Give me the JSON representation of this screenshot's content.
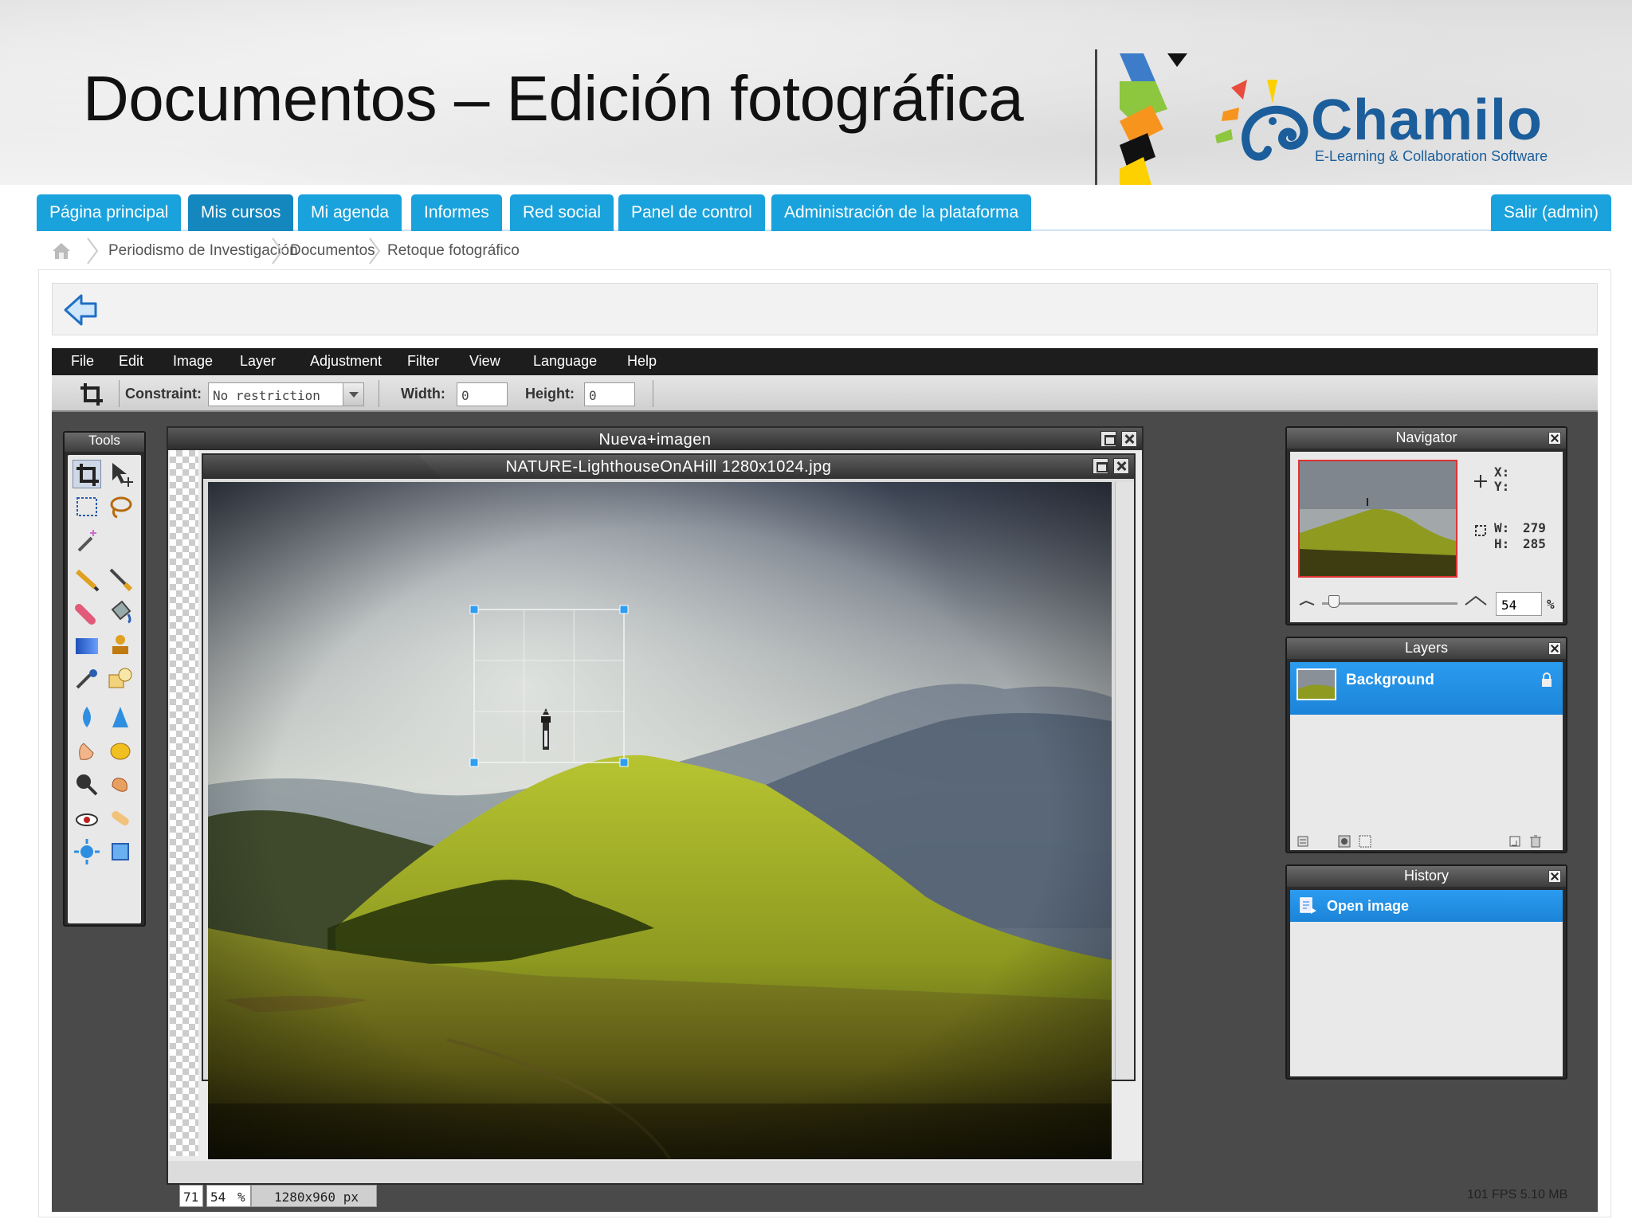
{
  "slide": {
    "title": "Documentos – Edición fotográfica",
    "logo_name": "Chamilo",
    "logo_tagline": "E-Learning & Collaboration Software"
  },
  "nav": {
    "tabs": [
      {
        "label": "Página principal",
        "active": false
      },
      {
        "label": "Mis cursos",
        "active": true
      },
      {
        "label": "Mi agenda",
        "active": false
      },
      {
        "label": "Informes",
        "active": false
      },
      {
        "label": "Red social",
        "active": false
      },
      {
        "label": "Panel de control",
        "active": false
      },
      {
        "label": "Administración de la plataforma",
        "active": false
      }
    ],
    "logout": "Salir (admin)"
  },
  "breadcrumb": [
    "Periodismo de Investigación",
    "Documentos",
    "Retoque fotográfico"
  ],
  "editor": {
    "menu": [
      "File",
      "Edit",
      "Image",
      "Layer",
      "Adjustment",
      "Filter",
      "View",
      "Language",
      "Help"
    ],
    "options": {
      "constraint_label": "Constraint:",
      "constraint_value": "No restriction",
      "width_label": "Width:",
      "width_value": "0",
      "height_label": "Height:",
      "height_value": "0"
    },
    "tools_title": "Tools",
    "tools": [
      "crop-tool-icon",
      "move-tool-icon",
      "rect-select-icon",
      "lasso-icon",
      "magic-wand-icon",
      "pencil-icon",
      "brush-icon",
      "eraser-icon",
      "paint-bucket-icon",
      "gradient-icon",
      "clone-stamp-icon",
      "color-replace-icon",
      "shape-icon",
      "blur-icon",
      "sharpen-icon",
      "smudge-icon",
      "sponge-icon",
      "dodge-icon",
      "burn-icon",
      "red-eye-icon",
      "spot-heal-icon",
      "bloat-icon",
      "pinch-icon",
      "color-picker-icon",
      "text-tool-icon",
      "hand-tool-icon",
      "zoom-tool-icon"
    ],
    "document_window_title": "Nueva+imagen",
    "image_window_title": "NATURE-LighthouseOnAHill  1280x1024.jpg",
    "status": {
      "left_value": "71",
      "zoom": "54",
      "zoom_unit": "%",
      "dimensions": "1280x960 px"
    },
    "fps": "101 FPS 5.10 MB"
  },
  "navigator": {
    "title": "Navigator",
    "x_label": "X:",
    "y_label": "Y:",
    "w_label": "W:",
    "w_value": "279",
    "h_label": "H:",
    "h_value": "285",
    "zoom_value": "54",
    "zoom_unit": "%"
  },
  "layers": {
    "title": "Layers",
    "items": [
      {
        "name": "Background"
      }
    ]
  },
  "history": {
    "title": "History",
    "items": [
      {
        "label": "Open image"
      }
    ]
  },
  "colors": {
    "tab_blue": "#1aa2dc",
    "tab_active": "#1587bf",
    "selection_blue": "#2b9cf0",
    "editor_bg": "#4a4a4a",
    "brand": "#1b5e9b"
  }
}
